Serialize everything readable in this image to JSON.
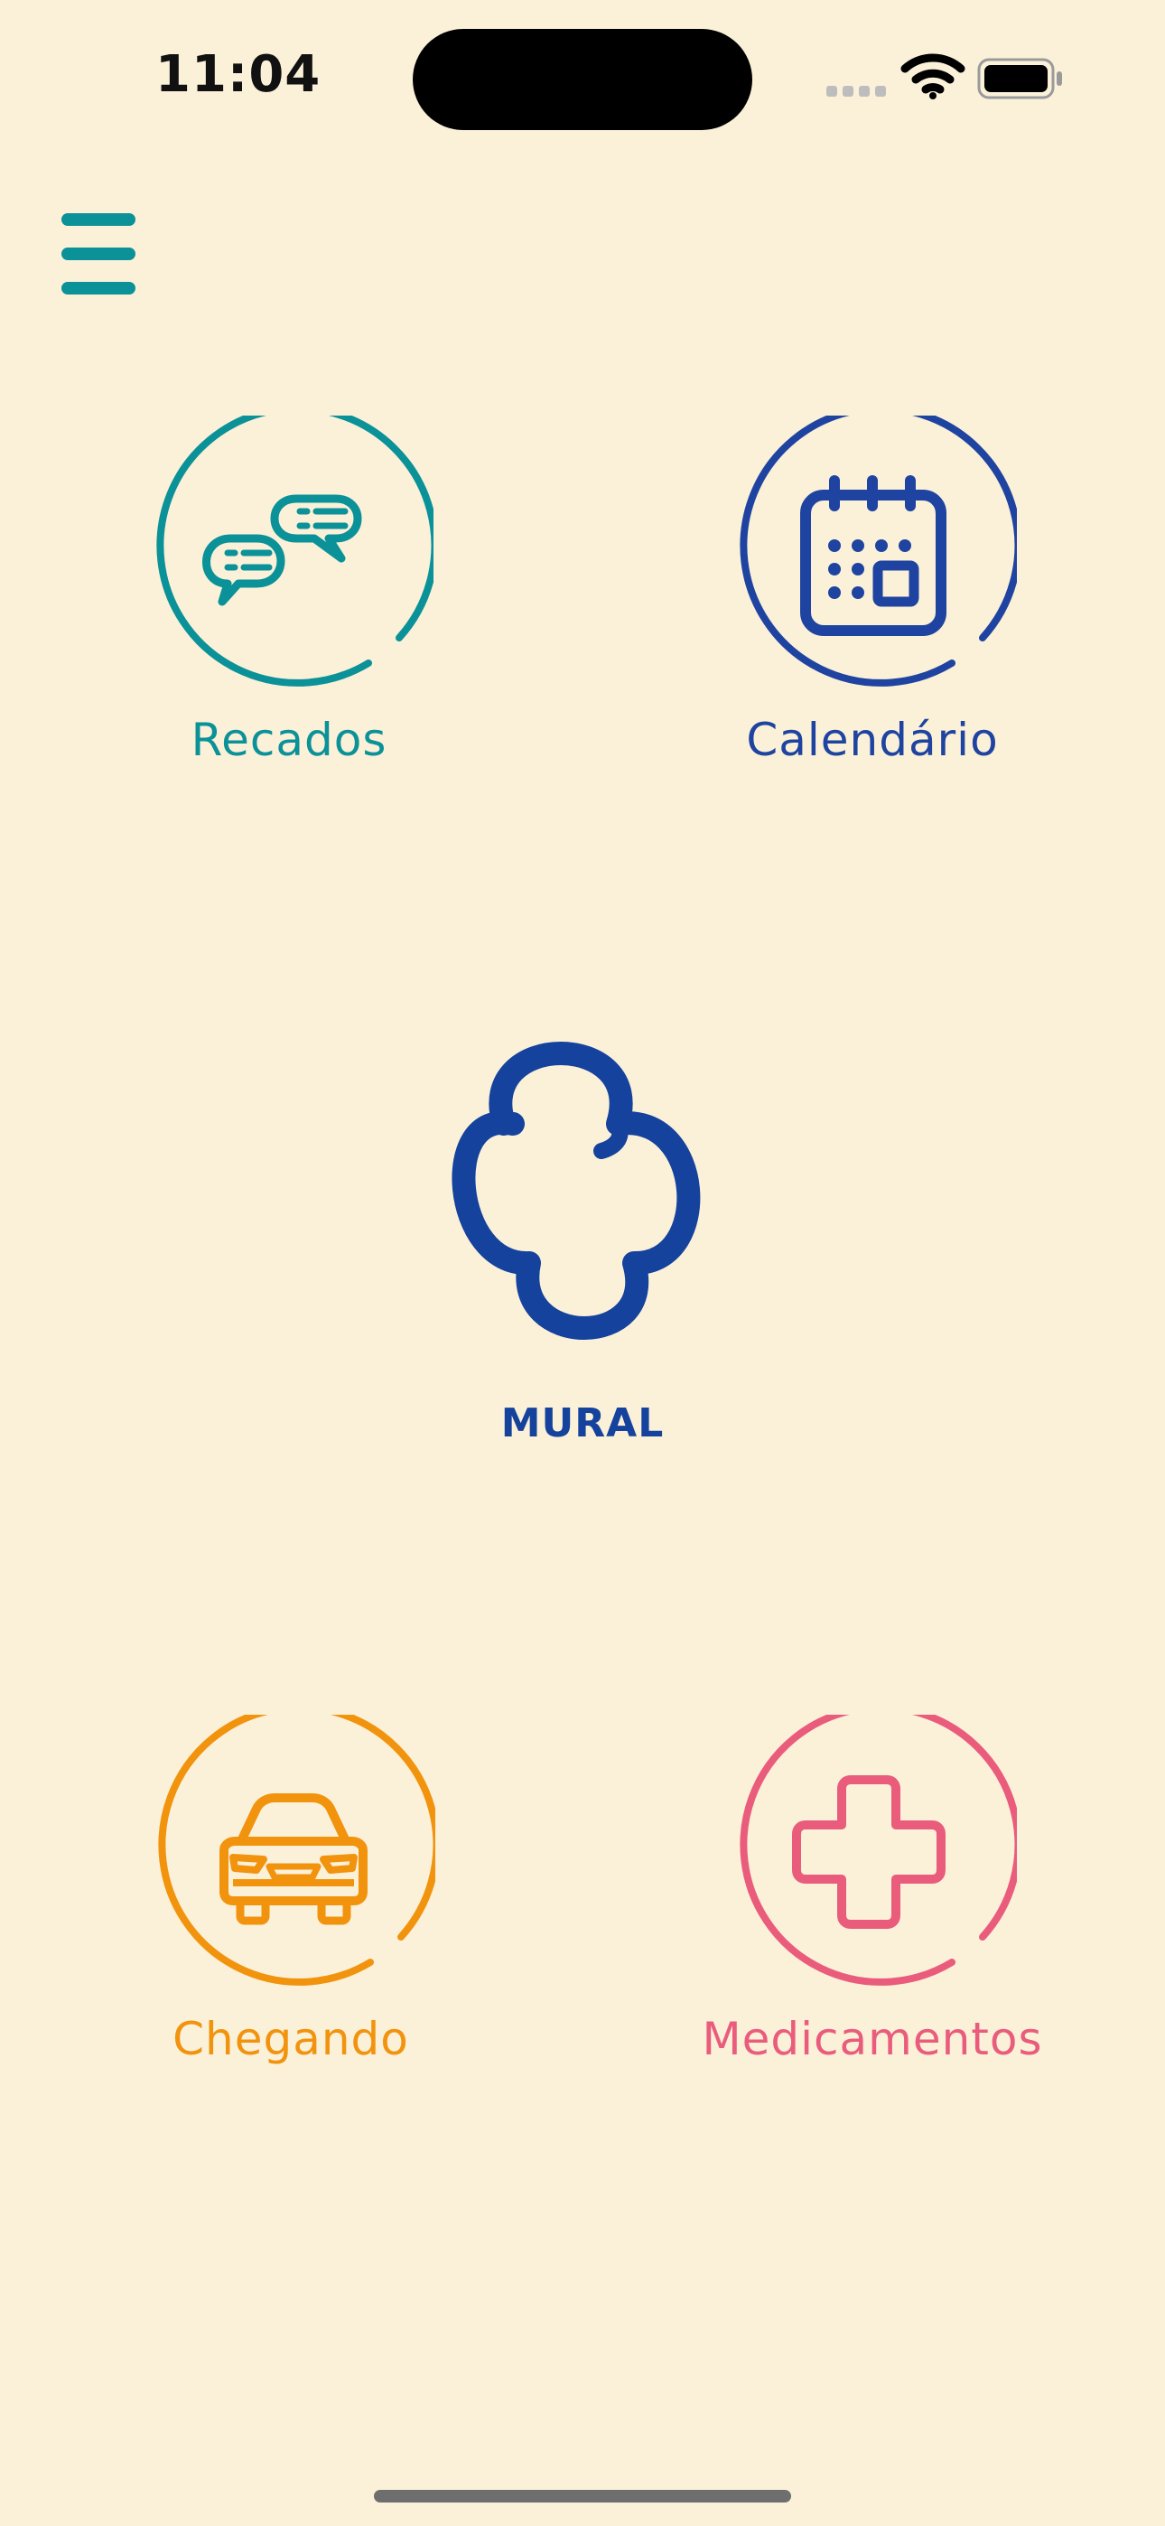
{
  "status_bar": {
    "time": "11:04"
  },
  "menu": {
    "icon": "hamburger-menu-icon"
  },
  "tiles": {
    "recados": {
      "label": "Recados",
      "color": "#0B9198",
      "icon": "chat-bubbles-icon"
    },
    "calendario": {
      "label": "Calendário",
      "color": "#1F43A0",
      "icon": "calendar-icon"
    },
    "mural": {
      "label": "MURAL",
      "color": "#14429C",
      "icon": "clover-logo-icon"
    },
    "chegando": {
      "label": "Chegando",
      "color": "#F2930E",
      "icon": "car-icon"
    },
    "medicamentos": {
      "label": "Medicamentos",
      "color": "#EA5C7C",
      "icon": "medical-cross-icon"
    }
  },
  "colors": {
    "background": "#FBF1D9"
  }
}
